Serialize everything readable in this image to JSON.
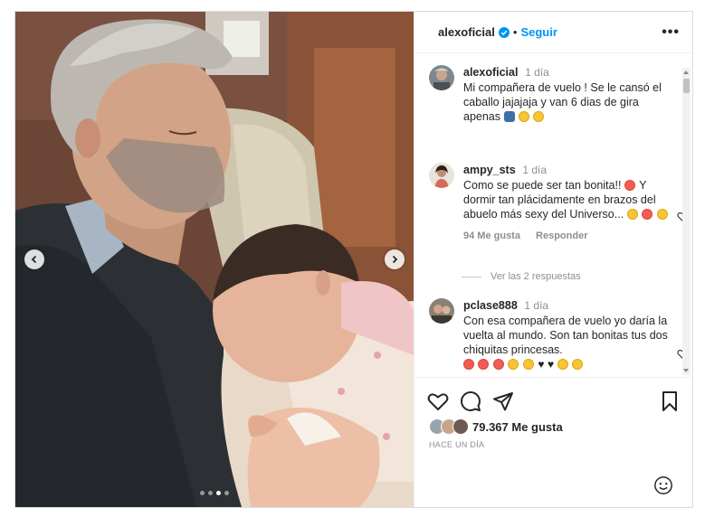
{
  "post": {
    "username": "alexoficial",
    "follow_label": "Seguir",
    "more_label": "•••",
    "separator": "•",
    "carousel": {
      "total_slides": 4,
      "active_slide": 3
    }
  },
  "caption": {
    "username": "alexoficial",
    "time": "1 día",
    "text": "Mi compañera de vuelo ! Se le cansó el caballo jajajaja y van 6 dias de gira apenas"
  },
  "comments": [
    {
      "username": "ampy_sts",
      "time": "1 día",
      "text": "Como se puede ser tan bonita!!",
      "text2": "Y dormir tan plácidamente en brazos del abuelo más sexy del Universo...",
      "likes": "94 Me gusta",
      "reply_label": "Responder",
      "view_replies": "Ver las 2 respuestas"
    },
    {
      "username": "pclase888",
      "time": "1 día",
      "text": "Con esa compañera de vuelo yo daría la vuelta al mundo. Son tan bonitas tus dos chiquitas princesas."
    }
  ],
  "footer": {
    "likes": "79.367 Me gusta",
    "time_ago": "HACE UN DÍA"
  },
  "colors": {
    "accent": "#0095f6",
    "verified": "#0095f6",
    "muted": "#8e8e8e",
    "text": "#262626"
  },
  "icons": [
    "chevron-left-icon",
    "chevron-right-icon",
    "verified-icon",
    "more-icon",
    "heart-icon",
    "comment-icon",
    "share-icon",
    "bookmark-icon",
    "emoji-icon"
  ]
}
